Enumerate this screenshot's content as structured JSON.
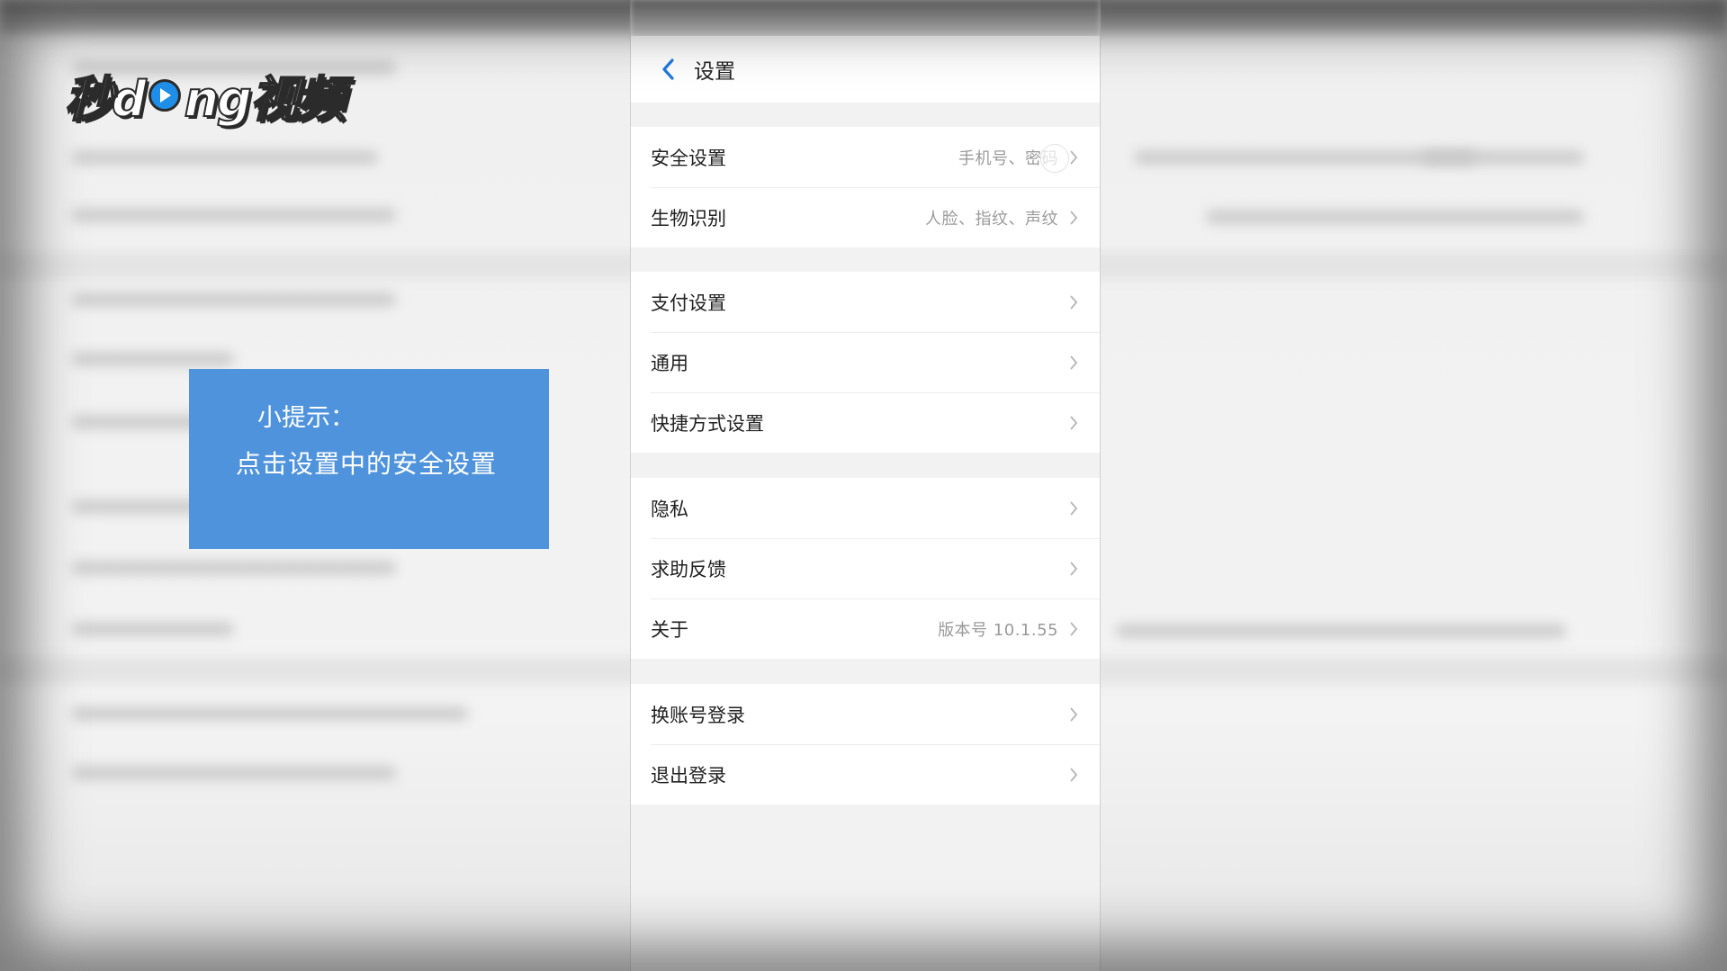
{
  "logo": {
    "text_left": "秒d",
    "text_right": "ng视频"
  },
  "tip": {
    "title": "小提示：",
    "body": "点击设置中的安全设置"
  },
  "header": {
    "title": "设置"
  },
  "groups": [
    {
      "items": [
        {
          "label": "安全设置",
          "value": "手机号、密码"
        },
        {
          "label": "生物识别",
          "value": "人脸、指纹、声纹"
        }
      ]
    },
    {
      "items": [
        {
          "label": "支付设置",
          "value": ""
        },
        {
          "label": "通用",
          "value": ""
        },
        {
          "label": "快捷方式设置",
          "value": ""
        }
      ]
    },
    {
      "items": [
        {
          "label": "隐私",
          "value": ""
        },
        {
          "label": "求助反馈",
          "value": ""
        },
        {
          "label": "关于",
          "value": "版本号 10.1.55"
        }
      ]
    },
    {
      "items": [
        {
          "label": "换账号登录",
          "value": ""
        },
        {
          "label": "退出登录",
          "value": ""
        }
      ]
    }
  ],
  "colors": {
    "accent": "#1f7ae0",
    "tip_background": "#4f93dc",
    "panel_background": "#f2f2f2"
  },
  "icons": {
    "back": "chevron-left-icon",
    "row_arrow": "chevron-right-icon",
    "logo_play": "play-icon"
  }
}
